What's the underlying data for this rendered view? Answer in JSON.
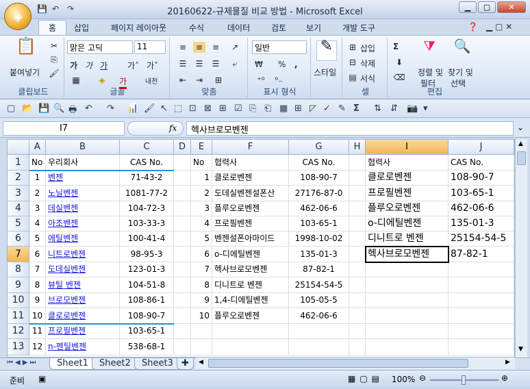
{
  "window": {
    "title": "20160622-규제물질 비교 방법 - Microsoft Excel",
    "minimize": "▁",
    "maximize": "▢",
    "close": "✕"
  },
  "tabs": [
    "홈",
    "삽입",
    "페이지 레이아웃",
    "수식",
    "데이터",
    "검토",
    "보기",
    "개발 도구"
  ],
  "ribbon": {
    "clipboard": {
      "paste": "붙여넣기",
      "label": "클립보드"
    },
    "font": {
      "name": "맑은 고딕",
      "size": "11",
      "label": "글꼴",
      "bold": "가",
      "italic": "가",
      "underline": "가",
      "grow": "가˄",
      "shrink": "가˅",
      "phonetic": "내천"
    },
    "align": {
      "label": "맞춤"
    },
    "number": {
      "format": "일반",
      "label": "표시 형식",
      "currency": "₩",
      "percent": "%",
      "comma": ","
    },
    "style": {
      "label": "스타일"
    },
    "cells": {
      "insert": "삽입",
      "delete": "삭제",
      "format": "서식",
      "label": "셀"
    },
    "edit": {
      "sort": "정렬 및",
      "sort2": "필터",
      "find": "찾기 및",
      "find2": "선택",
      "sum": "Σ",
      "label": "편집"
    }
  },
  "formula_bar": {
    "name_box": "I7",
    "fx": "fx",
    "content": "헥사브로모벤젠"
  },
  "columns": [
    "A",
    "B",
    "C",
    "D",
    "E",
    "F",
    "G",
    "H",
    "I",
    "J"
  ],
  "rows": [
    "1",
    "2",
    "3",
    "4",
    "5",
    "6",
    "7",
    "8",
    "9",
    "10",
    "11",
    "12",
    "13"
  ],
  "table_left": {
    "headers": [
      "No",
      "우리회사",
      "CAS No."
    ],
    "rows": [
      [
        "1",
        "벤젠",
        "71-43-2"
      ],
      [
        "2",
        "노닐벤젠",
        "1081-77-2"
      ],
      [
        "3",
        "데실벤젠",
        "104-72-3"
      ],
      [
        "4",
        "아조벤젠",
        "103-33-3"
      ],
      [
        "5",
        "에틸벤젠",
        "100-41-4"
      ],
      [
        "6",
        "니트로벤젠",
        "98-95-3"
      ],
      [
        "7",
        "도데실벤젠",
        "123-01-3"
      ],
      [
        "8",
        "뷰틸 벤젠",
        "104-51-8"
      ],
      [
        "9",
        "브로모벤젠",
        "108-86-1"
      ],
      [
        "10",
        "클로로벤젠",
        "108-90-7"
      ],
      [
        "11",
        "프로필벤젠",
        "103-65-1"
      ],
      [
        "12",
        "n-펜틸벤젠",
        "538-68-1"
      ]
    ]
  },
  "table_mid": {
    "headers": [
      "No",
      "협력사",
      "CAS No."
    ],
    "rows": [
      [
        "1",
        "클로로벤젠",
        "108-90-7"
      ],
      [
        "2",
        "도데실벤젠설폰산",
        "27176-87-0"
      ],
      [
        "3",
        "플루오로벤젠",
        "462-06-6"
      ],
      [
        "4",
        "프로필벤젠",
        "103-65-1"
      ],
      [
        "5",
        "벤젠설폰아마이드",
        "1998-10-02"
      ],
      [
        "6",
        "o-디에틸벤젠",
        "135-01-3"
      ],
      [
        "7",
        "헥사브로모벤젠",
        "87-82-1"
      ],
      [
        "8",
        "디니트로 벤젠",
        "25154-54-5"
      ],
      [
        "9",
        "1,4-디에틸벤젠",
        "105-05-5"
      ],
      [
        "10",
        "플루오로벤젠",
        "462-06-6"
      ]
    ]
  },
  "table_right": {
    "headers": [
      "협력사",
      "CAS No."
    ],
    "rows": [
      [
        "클로로벤젠",
        "108-90-7"
      ],
      [
        "프로필벤젠",
        "103-65-1"
      ],
      [
        "플루오로벤젠",
        "462-06-6"
      ],
      [
        "o-디에틸벤젠",
        "135-01-3"
      ],
      [
        "디니트로 벤젠",
        "25154-54-5"
      ],
      [
        "헥사브로모벤젠",
        "87-82-1"
      ]
    ]
  },
  "sheets": [
    "Sheet1",
    "Sheet2",
    "Sheet3"
  ],
  "status": {
    "ready": "준비",
    "zoom": "100%"
  },
  "colors": {
    "header_underline": "#2a8fc9",
    "selection": "#000000",
    "link": "#1a1ad6"
  }
}
